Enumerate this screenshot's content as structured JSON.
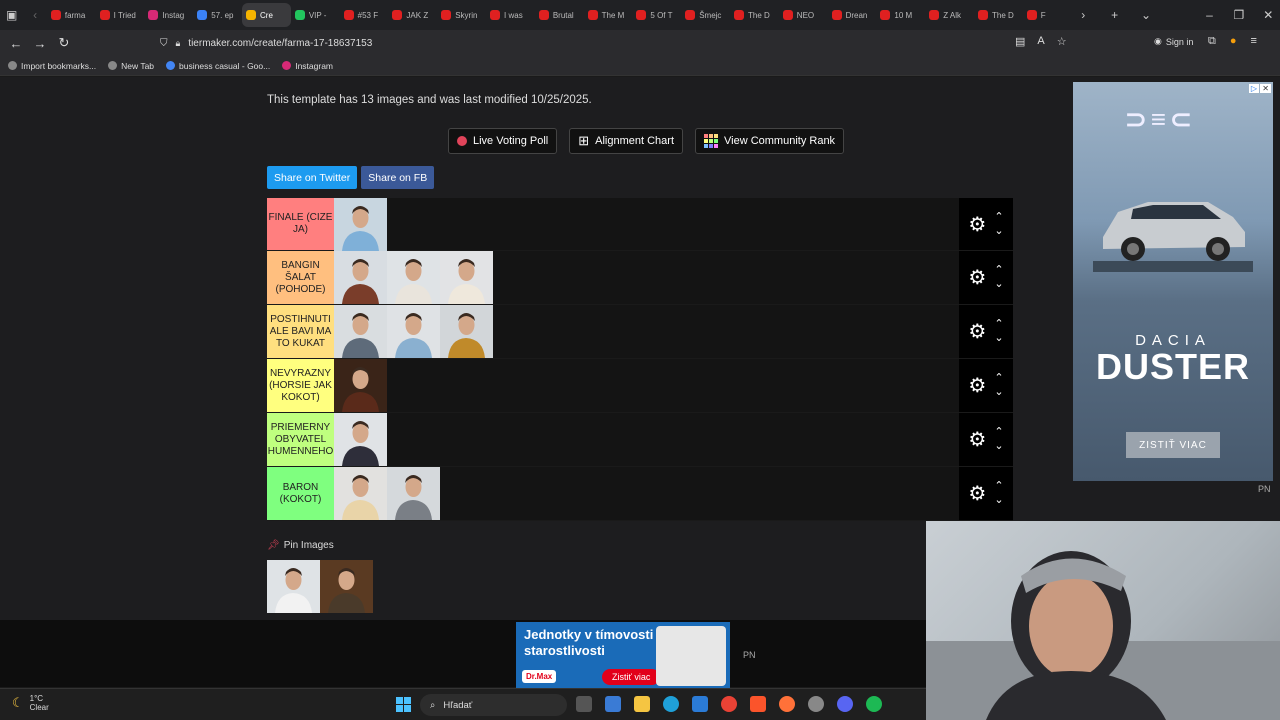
{
  "tabs": [
    {
      "label": "farma",
      "color": "#e02020"
    },
    {
      "label": "I Tried",
      "color": "#e02020"
    },
    {
      "label": "Instag",
      "color": "#d62976"
    },
    {
      "label": "57. ep",
      "color": "#3b82f6"
    },
    {
      "label": "Cre",
      "color": "#f5b400",
      "active": true
    },
    {
      "label": "VIP -",
      "color": "#22c55e"
    },
    {
      "label": "#53 F",
      "color": "#e02020"
    },
    {
      "label": "JAK Z",
      "color": "#e02020"
    },
    {
      "label": "Skyrin",
      "color": "#e02020"
    },
    {
      "label": "I was",
      "color": "#e02020"
    },
    {
      "label": "Brutal",
      "color": "#e02020"
    },
    {
      "label": "The M",
      "color": "#e02020"
    },
    {
      "label": "5 Of T",
      "color": "#e02020"
    },
    {
      "label": "Šmejc",
      "color": "#e02020"
    },
    {
      "label": "The D",
      "color": "#e02020"
    },
    {
      "label": "NEO",
      "color": "#e02020"
    },
    {
      "label": "Drean",
      "color": "#e02020"
    },
    {
      "label": "10 M",
      "color": "#e02020"
    },
    {
      "label": "Z Alk",
      "color": "#e02020"
    },
    {
      "label": "The D",
      "color": "#e02020"
    },
    {
      "label": "F",
      "color": "#e02020"
    }
  ],
  "browser": {
    "url": "tiermaker.com/create/farma-17-18637153",
    "sign_in": "Sign in"
  },
  "bookmarks": [
    {
      "label": "Import bookmarks...",
      "color": "#888"
    },
    {
      "label": "New Tab",
      "color": "#888"
    },
    {
      "label": "business casual - Goo...",
      "color": "#4285f4"
    },
    {
      "label": "Instagram",
      "color": "#d62976"
    }
  ],
  "page": {
    "info": "This template has 13 images and was last modified 10/25/2025.",
    "buttons": {
      "voting": "Live Voting Poll",
      "alignment": "Alignment Chart",
      "community": "View Community Rank"
    },
    "share_twitter": "Share on Twitter",
    "share_fb": "Share on FB",
    "pin_images": "Pin Images"
  },
  "tiers": [
    {
      "label": "FINALE (CIZE JA)",
      "color": "#ff7f7f",
      "images": [
        {
          "bg": "#c8d6e0",
          "shirt": "#7fb0d8"
        }
      ]
    },
    {
      "label": "BANGIN ŠALAT (POHODE)",
      "color": "#ffbf7f",
      "images": [
        {
          "bg": "#d8dde2",
          "shirt": "#7a3d2a"
        },
        {
          "bg": "#dfe3e6",
          "shirt": "#e9e4dc"
        },
        {
          "bg": "#e2e3e5",
          "shirt": "#efe8dc"
        }
      ]
    },
    {
      "label": "POSTIHNUTI ALE BAVI MA TO KUKAT",
      "color": "#ffdf7f",
      "images": [
        {
          "bg": "#d9dde0",
          "shirt": "#5e6b7a"
        },
        {
          "bg": "#dfe2e5",
          "shirt": "#8ab0d0"
        },
        {
          "bg": "#d2d6d9",
          "shirt": "#c08a2a"
        }
      ]
    },
    {
      "label": "NEVYRAZNY (HORSIE JAK KOKOT)",
      "color": "#ffff7f",
      "images": [
        {
          "bg": "#3a2418",
          "shirt": "#5a2a1a"
        }
      ]
    },
    {
      "label": "PRIEMERNY OBYVATEL HUMENNEHO",
      "color": "#bfff7f",
      "images": [
        {
          "bg": "#e0e3e6",
          "shirt": "#2e2e3a"
        }
      ]
    },
    {
      "label": "BARON (KOKOT)",
      "color": "#7fff7f",
      "images": [
        {
          "bg": "#e2e1df",
          "shirt": "#e9d4a8"
        },
        {
          "bg": "#d5d9dc",
          "shirt": "#7a7f86"
        }
      ]
    }
  ],
  "pool": [
    {
      "bg": "#dfe3e6",
      "shirt": "#f2f2f2"
    },
    {
      "bg": "#5a3a22",
      "shirt": "#4a3a2a"
    }
  ],
  "ads": {
    "right": {
      "brand_top": "DACIA",
      "brand_main": "DUSTER",
      "cta": "ZISTIŤ VIAC",
      "tag": "PN"
    },
    "bottom": {
      "text": "Jednotky v tímovosti aj v starostlivosti",
      "logo": "Dr.Max",
      "cta": "Zistiť viac",
      "tag": "PN"
    }
  },
  "taskbar": {
    "temp": "1°C",
    "condition": "Clear",
    "search": "Hľadať"
  }
}
